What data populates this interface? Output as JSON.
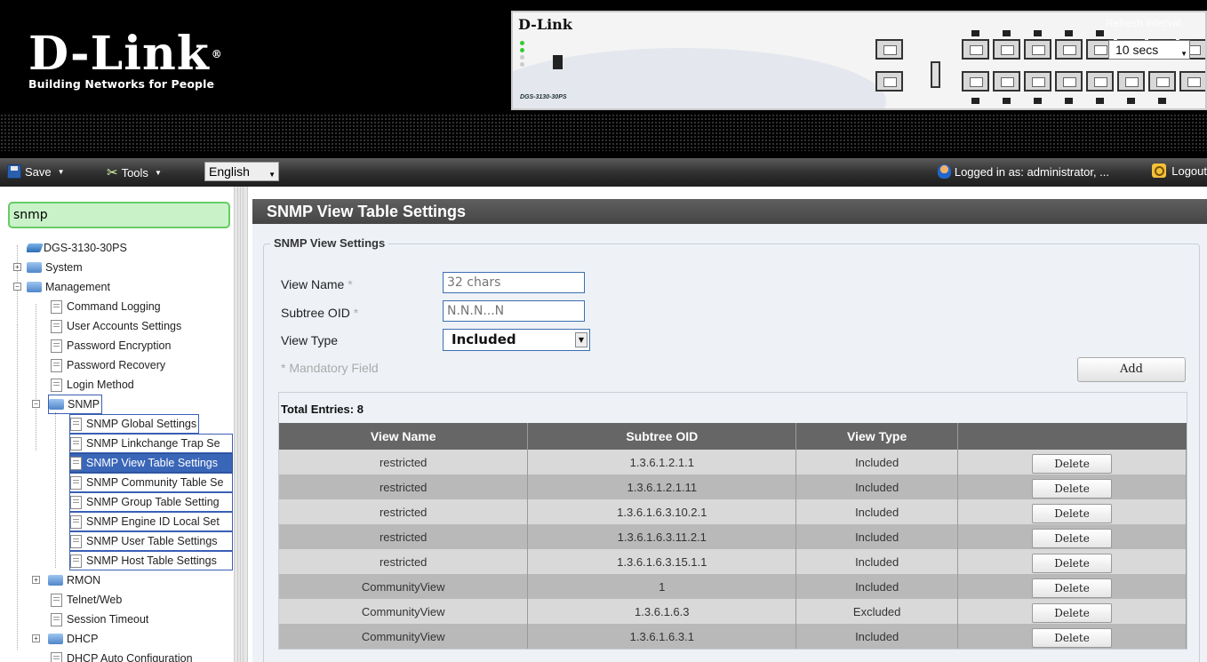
{
  "header": {
    "brand": "D-Link",
    "tagline": "Building Networks for People",
    "device_brand": "D-Link",
    "device_model": "DGS-3130-30PS",
    "refresh_label": "Refresh Interval",
    "refresh_value": "10 secs"
  },
  "toolbar": {
    "save_label": "Save",
    "tools_label": "Tools",
    "language": "English",
    "logged_in_text": "Logged in as: administrator, ...",
    "logout_label": "Logout"
  },
  "sidebar": {
    "search_value": "snmp",
    "tree": [
      {
        "label": "DGS-3130-30PS",
        "icon": "device-icon"
      },
      {
        "label": "System",
        "icon": "folder-icon",
        "toggle": "+"
      },
      {
        "label": "Management",
        "icon": "folder-open-icon",
        "toggle": "-"
      },
      {
        "label": "Command Logging",
        "icon": "document-icon"
      },
      {
        "label": "User Accounts Settings",
        "icon": "document-icon"
      },
      {
        "label": "Password Encryption",
        "icon": "document-icon"
      },
      {
        "label": "Password Recovery",
        "icon": "document-icon"
      },
      {
        "label": "Login Method",
        "icon": "document-icon"
      },
      {
        "label": "SNMP",
        "icon": "folder-open-icon",
        "toggle": "-"
      },
      {
        "label": "SNMP Global Settings",
        "icon": "document-icon"
      },
      {
        "label": "SNMP Linkchange Trap Se",
        "icon": "document-icon"
      },
      {
        "label": "SNMP View Table Settings",
        "icon": "document-icon"
      },
      {
        "label": "SNMP Community Table Se",
        "icon": "document-icon"
      },
      {
        "label": "SNMP Group Table Setting",
        "icon": "document-icon"
      },
      {
        "label": "SNMP Engine ID Local Set",
        "icon": "document-icon"
      },
      {
        "label": "SNMP User Table Settings",
        "icon": "document-icon"
      },
      {
        "label": "SNMP Host Table Settings",
        "icon": "document-icon"
      },
      {
        "label": "RMON",
        "icon": "folder-icon",
        "toggle": "+"
      },
      {
        "label": "Telnet/Web",
        "icon": "document-icon"
      },
      {
        "label": "Session Timeout",
        "icon": "document-icon"
      },
      {
        "label": "DHCP",
        "icon": "folder-icon",
        "toggle": "+"
      },
      {
        "label": "DHCP Auto Configuration",
        "icon": "document-icon"
      }
    ]
  },
  "main": {
    "title": "SNMP View Table Settings",
    "section_title": "SNMP View Settings",
    "form": {
      "view_name_label": "View Name",
      "view_name_placeholder": "32 chars",
      "subtree_oid_label": "Subtree OID",
      "subtree_oid_placeholder": "N.N.N...N",
      "view_type_label": "View Type",
      "view_type_value": "Included",
      "required_mark": "*",
      "mandatory_note": "* Mandatory Field",
      "add_label": "Add"
    },
    "table": {
      "total": "Total Entries: 8",
      "headers": [
        "View Name",
        "Subtree OID",
        "View Type",
        ""
      ],
      "delete_label": "Delete",
      "rows": [
        [
          "restricted",
          "1.3.6.1.2.1.1",
          "Included"
        ],
        [
          "restricted",
          "1.3.6.1.2.1.11",
          "Included"
        ],
        [
          "restricted",
          "1.3.6.1.6.3.10.2.1",
          "Included"
        ],
        [
          "restricted",
          "1.3.6.1.6.3.11.2.1",
          "Included"
        ],
        [
          "restricted",
          "1.3.6.1.6.3.15.1.1",
          "Included"
        ],
        [
          "CommunityView",
          "1",
          "Included"
        ],
        [
          "CommunityView",
          "1.3.6.1.6.3",
          "Excluded"
        ],
        [
          "CommunityView",
          "1.3.6.1.6.3.1",
          "Included"
        ]
      ]
    }
  },
  "colors": {
    "accent": "#3a66b8",
    "title_bar": "#555555",
    "table_header": "#666666",
    "row_light": "#d9d9d9",
    "row_dark": "#b9b9b9",
    "content_bg": "#eef2f7",
    "search_bg": "#c9f2c9"
  }
}
